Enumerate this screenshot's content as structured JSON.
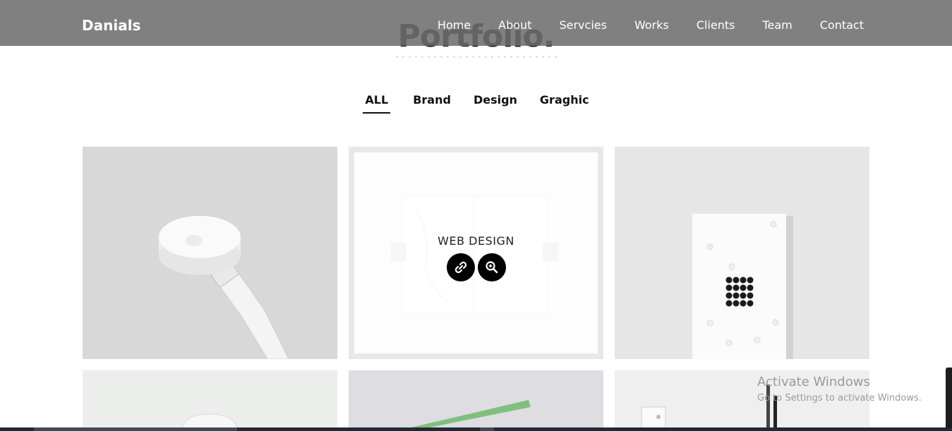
{
  "navbar": {
    "brand": "Danials",
    "links": [
      "Home",
      "About",
      "Servcies",
      "Works",
      "Clients",
      "Team",
      "Contact"
    ]
  },
  "section": {
    "title": "Portfolio."
  },
  "filters": {
    "items": [
      "ALL",
      "Brand",
      "Design",
      "Graghic"
    ],
    "active": "ALL"
  },
  "portfolio": {
    "hover_item": {
      "title": "WEB DESIGN",
      "link_icon": "link-icon",
      "zoom_icon": "zoom-in-icon"
    }
  },
  "watermark": {
    "line1": "Activate Windows",
    "line2": "Go to Settings to activate Windows."
  }
}
